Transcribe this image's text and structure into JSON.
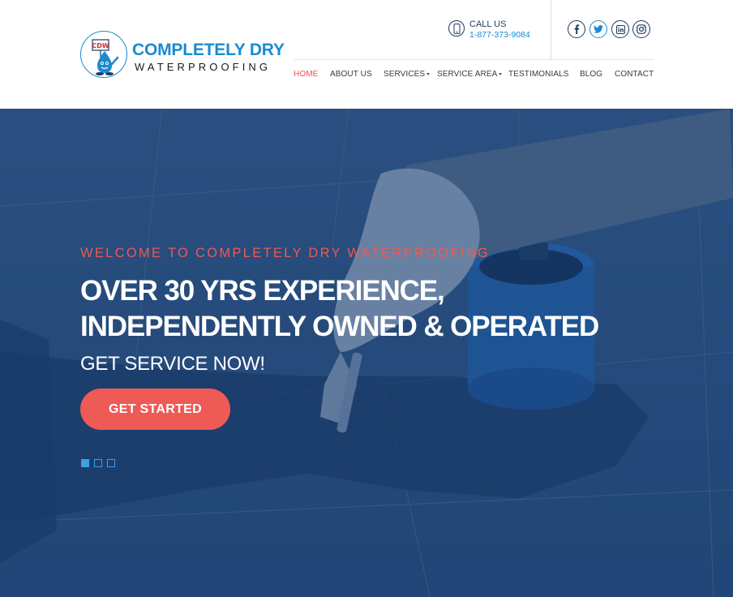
{
  "brand": {
    "line1": "COMPLETELY DRY",
    "line2": "WATERPROOFING",
    "colors": {
      "blue": "#1a8bd0",
      "navy": "#1c3a5e",
      "accent": "#ee5a55"
    }
  },
  "call": {
    "label": "CALL US",
    "number": "1-877-373-9084",
    "icon": "phone-icon"
  },
  "social": [
    {
      "name": "facebook",
      "glyph": "f"
    },
    {
      "name": "twitter",
      "glyph": "t"
    },
    {
      "name": "linkedin",
      "glyph": "in"
    },
    {
      "name": "instagram",
      "glyph": "ig"
    }
  ],
  "nav": [
    {
      "label": "HOME",
      "active": true
    },
    {
      "label": "ABOUT US"
    },
    {
      "label": "SERVICES",
      "dropdown": true
    },
    {
      "label": "SERVICE AREA",
      "dropdown": true
    },
    {
      "label": "TESTIMONIALS"
    },
    {
      "label": "BLOG"
    },
    {
      "label": "CONTACT"
    }
  ],
  "hero": {
    "kicker": "WELCOME TO COMPLETELY DRY WATERPROOFING",
    "headline_1": "OVER 30 YRS EXPERIENCE,",
    "headline_2": "INDEPENDENTLY OWNED & OPERATED",
    "subheading": "GET SERVICE NOW!",
    "cta": "GET STARTED",
    "slides": 3,
    "active_slide": 1
  }
}
